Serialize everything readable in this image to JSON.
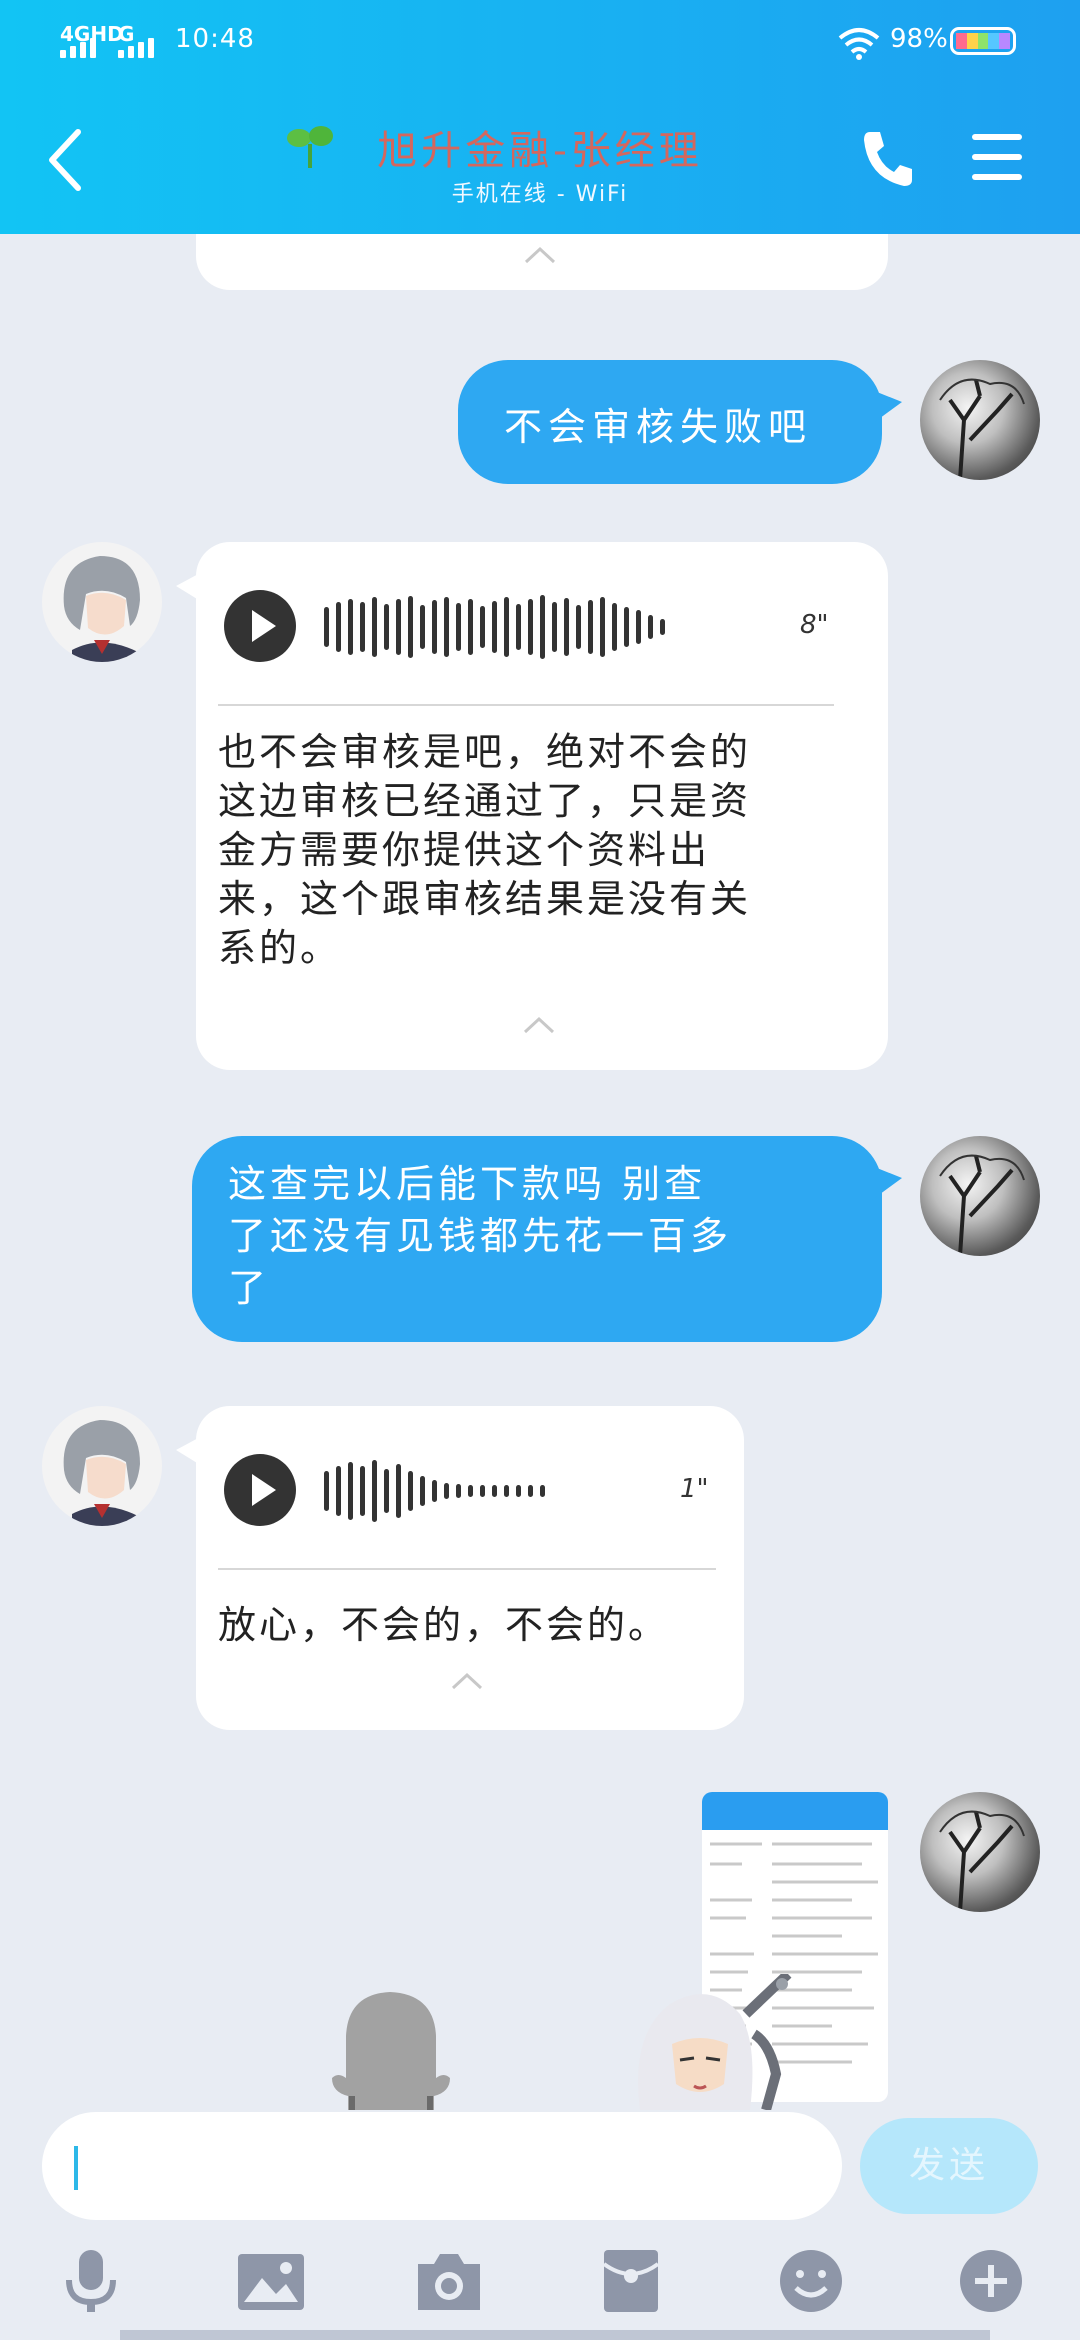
{
  "status": {
    "network_label_1": "4GHD",
    "network_label_2": "G",
    "time": "10:48",
    "battery_percent": "98%"
  },
  "header": {
    "title": "旭升金融-张经理",
    "subtitle": "手机在线 - WiFi"
  },
  "messages": [
    {
      "from": "me",
      "type": "text",
      "text": "不会审核失败吧"
    },
    {
      "from": "other",
      "type": "voice",
      "duration": "8\"",
      "lines": [
        "也不会审核是吧，绝对不会的",
        "这边审核已经通过了，只是资",
        "金方需要你提供这个资料出",
        "来，这个跟审核结果是没有关",
        "系的。"
      ]
    },
    {
      "from": "me",
      "type": "text",
      "lines": [
        "这查完以后能下款吗  别查",
        "了还没有见钱都先花一百多",
        "了"
      ]
    },
    {
      "from": "other",
      "type": "voice",
      "duration": "1\"",
      "lines": [
        "放心，不会的，不会的。"
      ]
    },
    {
      "from": "me",
      "type": "image",
      "image_caption": "screenshot"
    }
  ],
  "input": {
    "send_label": "发送"
  },
  "toolbar": {
    "icons": [
      "microphone-icon",
      "image-icon",
      "camera-icon",
      "red-packet-icon",
      "emoji-icon",
      "plus-icon"
    ]
  },
  "colors": {
    "header_start": "#12c4f4",
    "header_end": "#1ea0f0",
    "bubble_me": "#2ea8f2",
    "bubble_other": "#ffffff",
    "title_color": "#d4675e",
    "background": "#e8ecf3"
  }
}
